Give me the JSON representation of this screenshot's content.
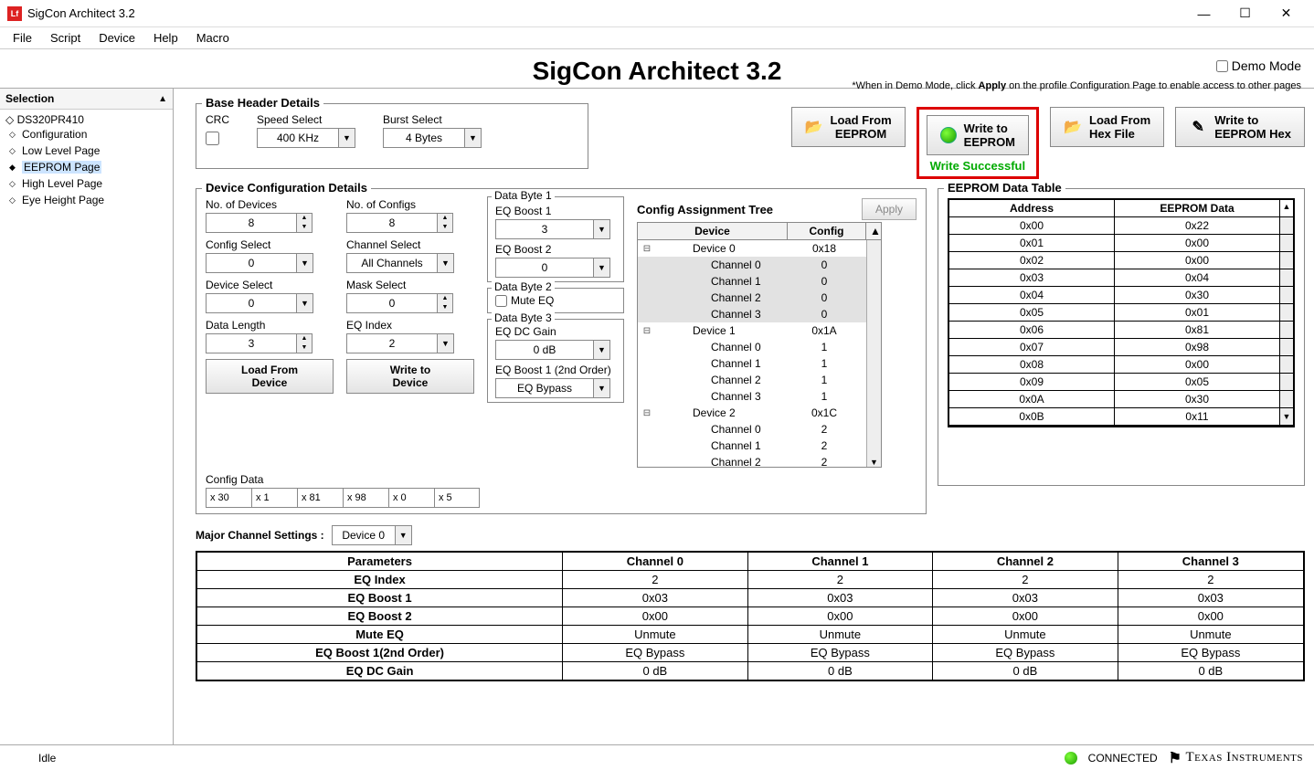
{
  "window": {
    "title": "SigCon Architect 3.2"
  },
  "menu": [
    "File",
    "Script",
    "Device",
    "Help",
    "Macro"
  ],
  "header": {
    "title": "SigCon Architect 3.2",
    "demo_label": "Demo Mode",
    "demo_note_prefix": "*When in Demo Mode, click ",
    "demo_note_bold": "Apply",
    "demo_note_suffix": " on the profile Configuration Page to enable access to other pages"
  },
  "sidebar": {
    "title": "Selection",
    "root": "DS320PR410",
    "items": [
      {
        "label": "Configuration",
        "selected": false
      },
      {
        "label": "Low Level Page",
        "selected": false
      },
      {
        "label": "EEPROM Page",
        "selected": true
      },
      {
        "label": "High Level Page",
        "selected": false
      },
      {
        "label": "Eye Height Page",
        "selected": false
      }
    ]
  },
  "base_header": {
    "legend": "Base Header Details",
    "crc_label": "CRC",
    "speed_label": "Speed Select",
    "speed_value": "400 KHz",
    "burst_label": "Burst Select",
    "burst_value": "4 Bytes"
  },
  "buttons": {
    "load_eeprom": "Load From EEPROM",
    "write_eeprom": "Write to EEPROM",
    "write_status": "Write Successful",
    "load_hex": "Load From Hex File",
    "write_hex": "Write to EEPROM Hex"
  },
  "dev_config": {
    "legend": "Device Configuration Details",
    "no_devices_label": "No. of Devices",
    "no_devices": "8",
    "no_configs_label": "No. of Configs",
    "no_configs": "8",
    "config_select_label": "Config Select",
    "config_select": "0",
    "channel_select_label": "Channel Select",
    "channel_select": "All Channels",
    "device_select_label": "Device Select",
    "device_select": "0",
    "mask_select_label": "Mask Select",
    "mask_select": "0",
    "data_length_label": "Data Length",
    "data_length": "3",
    "eq_index_label": "EQ Index",
    "eq_index": "2",
    "load_device_btn": "Load From Device",
    "write_device_btn": "Write to Device",
    "config_data_label": "Config Data",
    "config_data": [
      "x   30",
      "x    1",
      "x   81",
      "x   98",
      "x    0",
      "x    5"
    ],
    "db1_label": "Data Byte 1",
    "eq_boost1_label": "EQ Boost 1",
    "eq_boost1": "3",
    "eq_boost2_label": "EQ Boost 2",
    "eq_boost2": "0",
    "db2_label": "Data Byte 2",
    "mute_eq_label": "Mute EQ",
    "db3_label": "Data Byte 3",
    "eq_dc_gain_label": "EQ DC Gain",
    "eq_dc_gain": "0 dB",
    "eq_boost1_2nd_label": "EQ Boost 1 (2nd Order)",
    "eq_boost1_2nd": "EQ Bypass"
  },
  "config_tree": {
    "title": "Config Assignment Tree",
    "apply": "Apply",
    "hdr_device": "Device",
    "hdr_config": "Config",
    "rows": [
      {
        "exp": "⊟",
        "name": "Device 0",
        "cfg": "0x18",
        "indent": 40,
        "shade": false
      },
      {
        "exp": "",
        "name": "Channel 0",
        "cfg": "0",
        "indent": 60,
        "shade": true
      },
      {
        "exp": "",
        "name": "Channel 1",
        "cfg": "0",
        "indent": 60,
        "shade": true
      },
      {
        "exp": "",
        "name": "Channel 2",
        "cfg": "0",
        "indent": 60,
        "shade": true
      },
      {
        "exp": "",
        "name": "Channel 3",
        "cfg": "0",
        "indent": 60,
        "shade": true
      },
      {
        "exp": "⊟",
        "name": "Device 1",
        "cfg": "0x1A",
        "indent": 40,
        "shade": false
      },
      {
        "exp": "",
        "name": "Channel 0",
        "cfg": "1",
        "indent": 60,
        "shade": false
      },
      {
        "exp": "",
        "name": "Channel 1",
        "cfg": "1",
        "indent": 60,
        "shade": false
      },
      {
        "exp": "",
        "name": "Channel 2",
        "cfg": "1",
        "indent": 60,
        "shade": false
      },
      {
        "exp": "",
        "name": "Channel 3",
        "cfg": "1",
        "indent": 60,
        "shade": false
      },
      {
        "exp": "⊟",
        "name": "Device 2",
        "cfg": "0x1C",
        "indent": 40,
        "shade": false
      },
      {
        "exp": "",
        "name": "Channel 0",
        "cfg": "2",
        "indent": 60,
        "shade": false
      },
      {
        "exp": "",
        "name": "Channel 1",
        "cfg": "2",
        "indent": 60,
        "shade": false
      },
      {
        "exp": "",
        "name": "Channel 2",
        "cfg": "2",
        "indent": 60,
        "shade": false
      }
    ]
  },
  "eeprom": {
    "legend": "EEPROM Data Table",
    "hdr_addr": "Address",
    "hdr_data": "EEPROM Data",
    "rows": [
      {
        "addr": "0x00",
        "data": "0x22"
      },
      {
        "addr": "0x01",
        "data": "0x00"
      },
      {
        "addr": "0x02",
        "data": "0x00"
      },
      {
        "addr": "0x03",
        "data": "0x04"
      },
      {
        "addr": "0x04",
        "data": "0x30"
      },
      {
        "addr": "0x05",
        "data": "0x01"
      },
      {
        "addr": "0x06",
        "data": "0x81"
      },
      {
        "addr": "0x07",
        "data": "0x98"
      },
      {
        "addr": "0x08",
        "data": "0x00"
      },
      {
        "addr": "0x09",
        "data": "0x05"
      },
      {
        "addr": "0x0A",
        "data": "0x30"
      },
      {
        "addr": "0x0B",
        "data": "0x11"
      }
    ]
  },
  "major": {
    "label": "Major Channel Settings :",
    "device": "Device 0",
    "headers": [
      "Parameters",
      "Channel 0",
      "Channel 1",
      "Channel 2",
      "Channel 3"
    ],
    "rows": [
      [
        "EQ Index",
        "2",
        "2",
        "2",
        "2"
      ],
      [
        "EQ Boost 1",
        "0x03",
        "0x03",
        "0x03",
        "0x03"
      ],
      [
        "EQ Boost 2",
        "0x00",
        "0x00",
        "0x00",
        "0x00"
      ],
      [
        "Mute EQ",
        "Unmute",
        "Unmute",
        "Unmute",
        "Unmute"
      ],
      [
        "EQ Boost 1(2nd Order)",
        "EQ Bypass",
        "EQ Bypass",
        "EQ Bypass",
        "EQ Bypass"
      ],
      [
        "EQ DC Gain",
        "0 dB",
        "0 dB",
        "0 dB",
        "0 dB"
      ]
    ]
  },
  "status": {
    "idle": "Idle",
    "connected": "CONNECTED",
    "vendor": "Texas Instruments"
  }
}
